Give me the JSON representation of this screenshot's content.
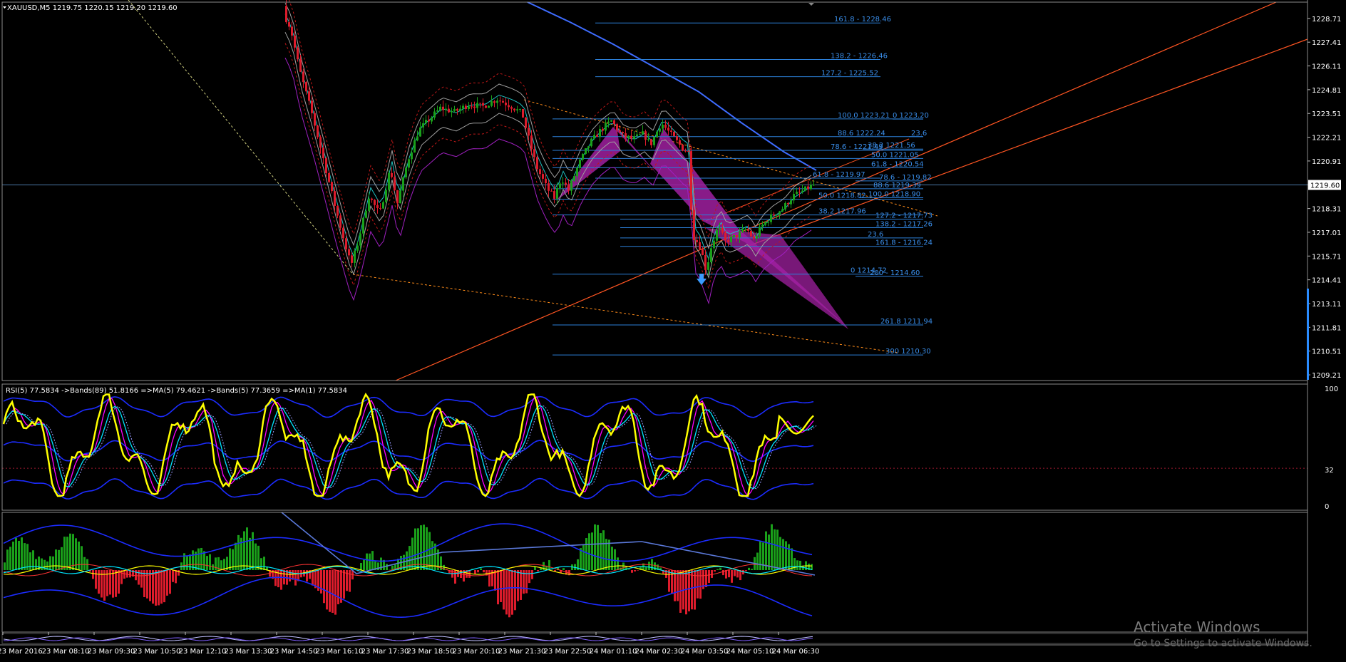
{
  "chart_data": {
    "type": "candlestick",
    "symbol_header": {
      "arrow": "triangle-down",
      "text": "XAUUSD,M5  1219.75 1220.15 1219.20 1219.60"
    },
    "price_axis": {
      "ticks": [
        "1228.71",
        "1227.41",
        "1226.11",
        "1224.81",
        "1223.51",
        "1222.21",
        "1220.91",
        "1219.60",
        "1218.31",
        "1217.01",
        "1215.71",
        "1214.41",
        "1213.11",
        "1211.81",
        "1210.51",
        "1209.21"
      ],
      "tick_values": [
        1228.71,
        1227.41,
        1226.11,
        1224.81,
        1223.51,
        1222.21,
        1220.91,
        1219.6,
        1218.31,
        1217.01,
        1215.71,
        1214.41,
        1213.11,
        1211.81,
        1210.51,
        1209.21
      ],
      "current_price": 1219.6,
      "range": [
        1208.9,
        1229.6
      ]
    },
    "time_axis": [
      "23 Mar 2016",
      "23 Mar 08:10",
      "23 Mar 09:30",
      "23 Mar 10:50",
      "23 Mar 12:10",
      "23 Mar 13:30",
      "23 Mar 14:50",
      "23 Mar 16:10",
      "23 Mar 17:30",
      "23 Mar 18:50",
      "23 Mar 20:10",
      "23 Mar 21:30",
      "23 Mar 22:50",
      "24 Mar 01:10",
      "24 Mar 02:30",
      "24 Mar 03:50",
      "24 Mar 05:10",
      "24 Mar 06:30"
    ],
    "price_path": [
      [
        395,
        1229.4
      ],
      [
        410,
        1228.2
      ],
      [
        422,
        1226.0
      ],
      [
        440,
        1223.5
      ],
      [
        455,
        1221.2
      ],
      [
        470,
        1218.8
      ],
      [
        485,
        1216.6
      ],
      [
        495,
        1215.2
      ],
      [
        505,
        1216.5
      ],
      [
        520,
        1219.0
      ],
      [
        535,
        1218.0
      ],
      [
        550,
        1220.5
      ],
      [
        560,
        1218.6
      ],
      [
        575,
        1221.0
      ],
      [
        590,
        1222.6
      ],
      [
        605,
        1223.2
      ],
      [
        620,
        1223.8
      ],
      [
        640,
        1223.6
      ],
      [
        660,
        1224.0
      ],
      [
        680,
        1223.9
      ],
      [
        700,
        1224.3
      ],
      [
        720,
        1223.9
      ],
      [
        735,
        1223.5
      ],
      [
        745,
        1222.0
      ],
      [
        755,
        1220.6
      ],
      [
        770,
        1219.4
      ],
      [
        780,
        1218.9
      ],
      [
        790,
        1220.0
      ],
      [
        800,
        1219.3
      ],
      [
        815,
        1220.8
      ],
      [
        830,
        1221.9
      ],
      [
        845,
        1222.6
      ],
      [
        860,
        1223.1
      ],
      [
        875,
        1222.3
      ],
      [
        890,
        1222.1
      ],
      [
        905,
        1222.4
      ],
      [
        915,
        1221.8
      ],
      [
        930,
        1223.0
      ],
      [
        945,
        1222.3
      ],
      [
        960,
        1221.6
      ],
      [
        968,
        1221.4
      ],
      [
        970,
        1219.5
      ],
      [
        975,
        1216.8
      ],
      [
        985,
        1216.2
      ],
      [
        993,
        1214.9
      ],
      [
        1000,
        1216.2
      ],
      [
        1010,
        1217.3
      ],
      [
        1020,
        1216.5
      ],
      [
        1035,
        1216.8
      ],
      [
        1050,
        1217.2
      ],
      [
        1060,
        1216.6
      ],
      [
        1070,
        1217.3
      ],
      [
        1085,
        1217.9
      ],
      [
        1100,
        1218.3
      ],
      [
        1115,
        1219.0
      ],
      [
        1130,
        1219.3
      ],
      [
        1143,
        1219.6
      ]
    ],
    "ma_slow": [
      [
        740,
        1229.6
      ],
      [
        800,
        1228.5
      ],
      [
        860,
        1227.3
      ],
      [
        920,
        1226.0
      ],
      [
        980,
        1224.7
      ],
      [
        1040,
        1223.0
      ],
      [
        1100,
        1221.4
      ],
      [
        1145,
        1220.4
      ]
    ],
    "fibonacci_levels": [
      {
        "label": "161.8 - 1228.46",
        "price": 1228.46
      },
      {
        "label": "138.2 - 1226.46",
        "price": 1226.46
      },
      {
        "label": "127.2 - 1225.52",
        "price": 1225.52
      },
      {
        "label": "100.0 1223.21",
        "price": 1223.21
      },
      {
        "label": "0 1223.20",
        "price": 1223.2
      },
      {
        "label": "88.6 1222.24",
        "price": 1222.24
      },
      {
        "label": "23.6",
        "price": 1222.24
      },
      {
        "label": "78.6 - 1221.49",
        "price": 1221.49
      },
      {
        "label": "38.2 1221.56",
        "price": 1221.56
      },
      {
        "label": "50.0 1221.05",
        "price": 1221.05
      },
      {
        "label": "61.8 - 1220.54",
        "price": 1220.54
      },
      {
        "label": "61.8 - 1219.97",
        "price": 1219.97
      },
      {
        "label": "78.6 - 1219.82",
        "price": 1219.82
      },
      {
        "label": "88.6 1219.39",
        "price": 1219.39
      },
      {
        "label": "50.0 1218.82",
        "price": 1218.82
      },
      {
        "label": "100.0 1218.90",
        "price": 1218.9
      },
      {
        "label": "38.2 1217.96",
        "price": 1217.96
      },
      {
        "label": "127.2 - 1217.73",
        "price": 1217.73
      },
      {
        "label": "138.2 - 1217.26",
        "price": 1217.26
      },
      {
        "label": "23.6",
        "price": 1216.7
      },
      {
        "label": "161.8 - 1216.24",
        "price": 1216.24
      },
      {
        "label": "0 1214.72",
        "price": 1214.72
      },
      {
        "label": "200 - 1214.60",
        "price": 1214.6
      },
      {
        "label": "261.8 1211.94",
        "price": 1211.94
      },
      {
        "label": "300 1210.30",
        "price": 1210.3
      }
    ],
    "rsi_panel": {
      "header": "RSI(5) 77.5834  ->Bands(89) 51.8166  =>MA(5) 79.4621  ->Bands(5) 77.3659  =>MA(1) 77.5834",
      "scale_top": "100",
      "scale_bottom": "0",
      "level_label": "32",
      "level": 32,
      "latest_value": 77.5834
    },
    "colors": {
      "background": "#000000",
      "candle_up": "#1aa01a",
      "candle_down": "#dd1c2c",
      "fib_line": "#2c7fd8",
      "fib_text": "#3a8eea",
      "harmonic_pattern": "#a020a0",
      "trend_line": "#ff5522",
      "rsi_line": "#ffff00",
      "rsi_signal": "#00e5ff",
      "hist_up": "#1aa01a",
      "hist_down": "#dd1c2c",
      "band_line": "#1c2cff"
    }
  },
  "watermark": {
    "title": "Activate Windows",
    "subtitle": "Go to Settings to activate Windows."
  }
}
